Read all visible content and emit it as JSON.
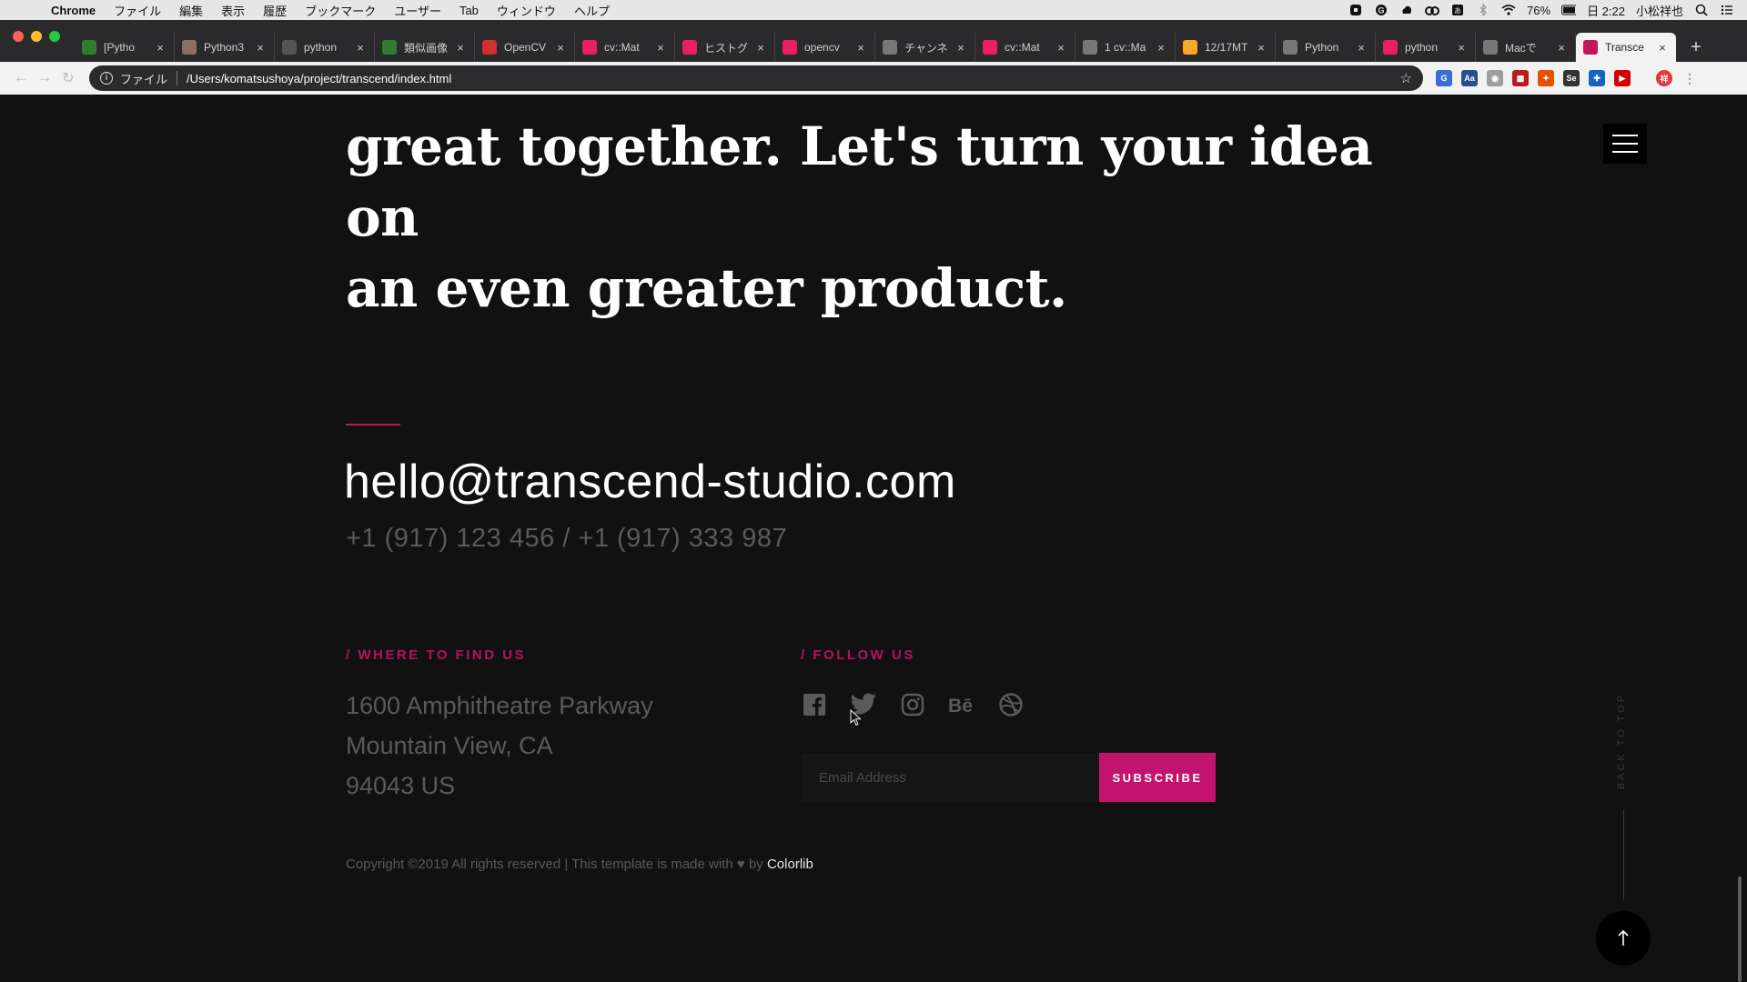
{
  "menubar": {
    "app": "Chrome",
    "items": [
      "ファイル",
      "編集",
      "表示",
      "履歴",
      "ブックマーク",
      "ユーザー",
      "Tab",
      "ウィンドウ",
      "ヘルプ"
    ],
    "battery": "76%",
    "clock": "日 2:22",
    "user": "小松祥也"
  },
  "tabs": [
    {
      "label": "[Pytho",
      "icon": "cc-icon",
      "color": "#2e7d32"
    },
    {
      "label": "Python3",
      "icon": "avatar-icon",
      "color": "#8d6e63"
    },
    {
      "label": "python",
      "icon": "info-icon",
      "color": "#555555"
    },
    {
      "label": "類似画像",
      "icon": "green-icon",
      "color": "#2e7d32"
    },
    {
      "label": "OpenCV",
      "icon": "opencv-icon",
      "color": "#d32f2f"
    },
    {
      "label": "cv::Mat",
      "icon": "qiita-icon",
      "color": "#e91e63"
    },
    {
      "label": "ヒストグ",
      "icon": "qiita-icon",
      "color": "#e91e63"
    },
    {
      "label": "opencv",
      "icon": "qiita-icon",
      "color": "#e91e63"
    },
    {
      "label": "チャンネ",
      "icon": "bird-icon",
      "color": "#777777"
    },
    {
      "label": "cv::Mat",
      "icon": "qiita-icon",
      "color": "#e91e63"
    },
    {
      "label": "1 cv::Ma",
      "icon": "globe-icon",
      "color": "#777777"
    },
    {
      "label": "12/17MT",
      "icon": "slides-icon",
      "color": "#f9a825"
    },
    {
      "label": "Python",
      "icon": "globe-icon",
      "color": "#777777"
    },
    {
      "label": "python",
      "icon": "qiita-icon",
      "color": "#e91e63"
    },
    {
      "label": "Macで",
      "icon": "apple-icon",
      "color": "#777777"
    },
    {
      "label": "Transce",
      "icon": "t-icon",
      "color": "#c2185b",
      "active": true
    }
  ],
  "toolbar": {
    "scheme": "ファイル",
    "url": "/Users/komatsushoya/project/transcend/index.html"
  },
  "page": {
    "headline_line1": "great together. Let's turn your idea on",
    "headline_line2": "an even greater product.",
    "email": "hello@transcend-studio.com",
    "phones": "+1 (917) 123 456 / +1 (917) 333 987",
    "find_label": "/ WHERE TO FIND US",
    "address": [
      "1600 Amphitheatre Parkway",
      "Mountain View, CA",
      "94043 US"
    ],
    "follow_label": "/ FOLLOW US",
    "socials": [
      "facebook-icon",
      "twitter-icon",
      "instagram-icon",
      "behance-icon",
      "dribbble-icon"
    ],
    "newsletter": {
      "placeholder": "Email Address",
      "button": "SUBSCRIBE"
    },
    "copyright_prefix": "Copyright ©2019 All rights reserved | This template is made with",
    "copyright_by": "by",
    "copyright_brand": "Colorlib",
    "back_to_top": "BACK TO TOP"
  },
  "colors": {
    "accent": "#c2146f",
    "background": "#111112",
    "muted_text": "#5a5a5c"
  }
}
